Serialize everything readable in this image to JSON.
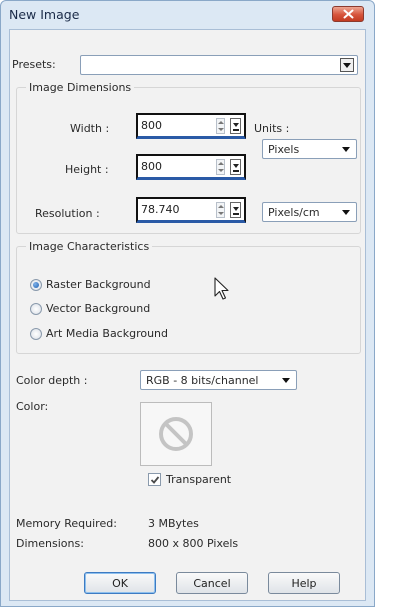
{
  "window": {
    "title": "New Image"
  },
  "presets": {
    "label": "Presets:",
    "value": ""
  },
  "image_dimensions": {
    "group_label": "Image Dimensions",
    "width_label": "Width :",
    "width_value": "800",
    "height_label": "Height :",
    "height_value": "800",
    "resolution_label": "Resolution :",
    "resolution_value": "78.740",
    "units_label": "Units :",
    "units_value": "Pixels",
    "resolution_units_value": "Pixels/cm"
  },
  "image_characteristics": {
    "group_label": "Image Characteristics",
    "options": [
      {
        "label": "Raster Background",
        "selected": true
      },
      {
        "label": "Vector Background",
        "selected": false
      },
      {
        "label": "Art Media Background",
        "selected": false
      }
    ],
    "color_depth_label": "Color depth :",
    "color_depth_value": "RGB - 8 bits/channel",
    "color_label": "Color:",
    "transparent_label": "Transparent",
    "transparent_checked": true
  },
  "info": {
    "memory_label": "Memory Required:",
    "memory_value": "3 MBytes",
    "dimensions_label": "Dimensions:",
    "dimensions_value": "800 x 800 Pixels"
  },
  "buttons": {
    "ok": "OK",
    "cancel": "Cancel",
    "help": "Help"
  },
  "colors": {
    "title_bar": "#dce8f4",
    "close_button": "#d6543c",
    "client_area": "#f2f2f2"
  }
}
